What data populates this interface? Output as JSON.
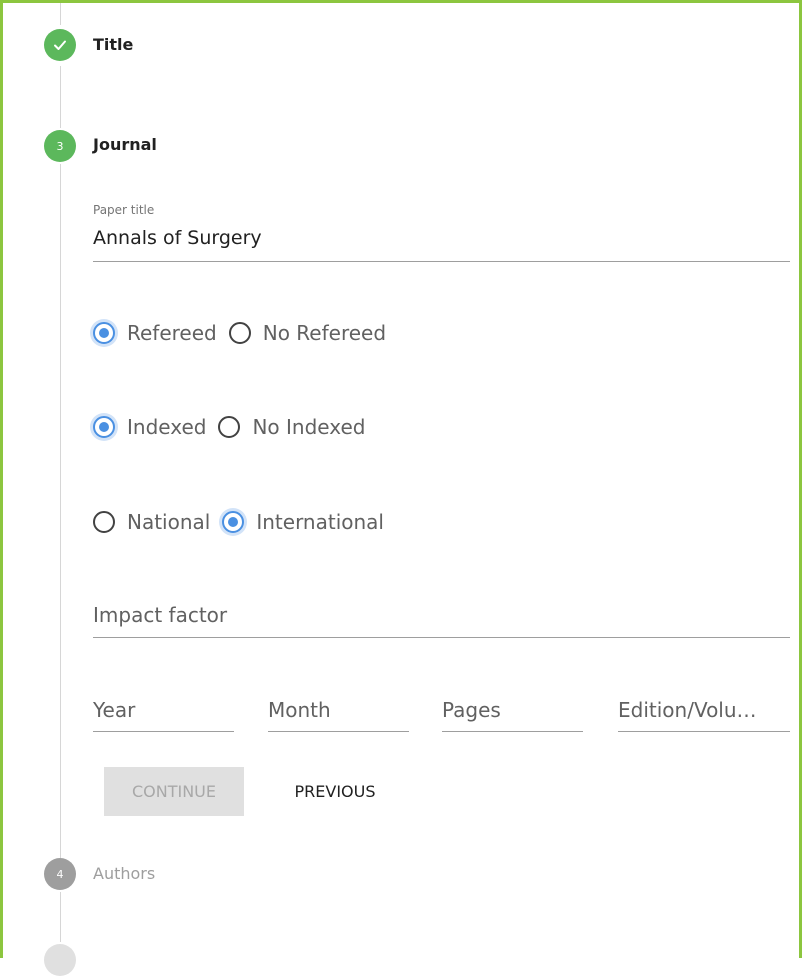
{
  "steps": {
    "title": {
      "label": "Title",
      "status": "done"
    },
    "journal": {
      "number": "3",
      "label": "Journal",
      "status": "active"
    },
    "authors": {
      "number": "4",
      "label": "Authors",
      "status": "pending"
    }
  },
  "form": {
    "paper_title": {
      "label": "Paper title",
      "value": "Annals of Surgery"
    },
    "refereed": {
      "options": [
        "Refereed",
        "No Refereed"
      ],
      "selected": "Refereed"
    },
    "indexed": {
      "options": [
        "Indexed",
        "No Indexed"
      ],
      "selected": "Indexed"
    },
    "scope": {
      "options": [
        "National",
        "International"
      ],
      "selected": "International"
    },
    "impact_factor": {
      "placeholder": "Impact factor"
    },
    "year": {
      "placeholder": "Year"
    },
    "month": {
      "placeholder": "Month"
    },
    "pages": {
      "placeholder": "Pages"
    },
    "edition": {
      "placeholder": "Edition/Volu…"
    }
  },
  "actions": {
    "continue_label": "CONTINUE",
    "previous_label": "PREVIOUS"
  },
  "colors": {
    "accent_blue": "#4a90e2",
    "step_green": "#5cb85c",
    "frame_green": "#8cc63f",
    "step_grey": "#9e9e9e"
  }
}
